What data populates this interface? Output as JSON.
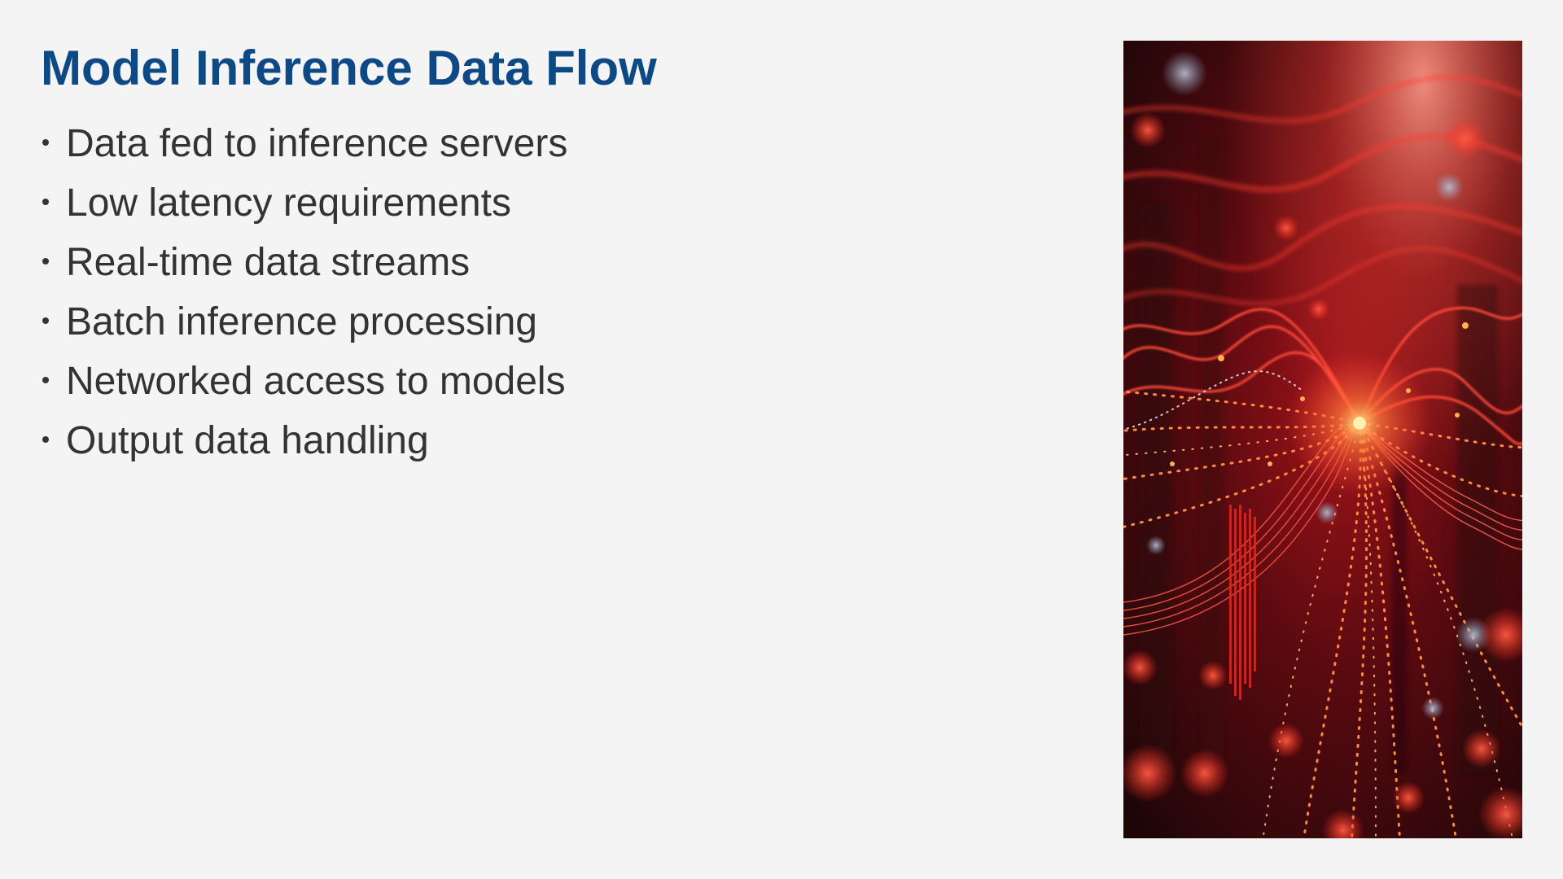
{
  "slide": {
    "title": "Model Inference Data Flow",
    "bullets": [
      "Data fed to inference servers",
      "Low latency requirements",
      "Real-time data streams",
      "Batch inference processing",
      "Networked access to models",
      "Output data handling"
    ],
    "image": {
      "icon": "abstract-red-data-flow-image"
    }
  },
  "colors": {
    "background": "#f4f4f4",
    "title": "#0d4a85",
    "body_text": "#333333",
    "image_glow": "#ff3b2f"
  }
}
